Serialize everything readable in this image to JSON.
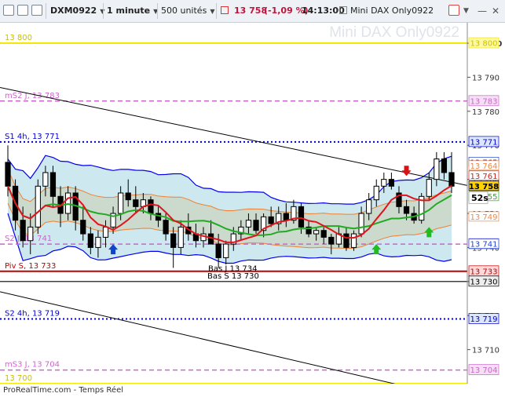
{
  "toolbar": {
    "ticker": "DXM0922",
    "interval": "1 minute",
    "units": "500 unités",
    "last_price": "13 758",
    "change": "(-1,09 %)",
    "time": "14:13:00",
    "instrument": "Mini DAX Only0922"
  },
  "colors": {
    "price_down": "#c0143c",
    "bollinger_fill": "#add8e6",
    "bollinger_line": "#0000ee",
    "sma_fast": "#e0141c",
    "sma_slow": "#22aa22",
    "keltner": "#f08030"
  },
  "watermark": "Mini DAX Only0922",
  "footer": "ProRealTime.com - Temps Réel",
  "countdown": "52s",
  "axis": {
    "min": 13700,
    "max": 13806,
    "ticks": [
      {
        "value": 13800,
        "label": "13 800"
      },
      {
        "value": 13790,
        "label": "13 790"
      },
      {
        "value": 13780,
        "label": "13 780"
      },
      {
        "value": 13770,
        "label": "13 770"
      },
      {
        "value": 13760,
        "label": "13 760"
      },
      {
        "value": 13750,
        "label": "13 750"
      },
      {
        "value": 13740,
        "label": "13 740"
      },
      {
        "value": 13730,
        "label": "13 730"
      },
      {
        "value": 13720,
        "label": "13 720"
      },
      {
        "value": 13710,
        "label": "13 710"
      }
    ]
  },
  "levels": [
    {
      "value": 13800,
      "label": "13 800",
      "style": "yellow",
      "tag": "13 800"
    },
    {
      "value": 13783,
      "label": "mS2 J, 13 783",
      "style": "violet",
      "tag": "13 783"
    },
    {
      "value": 13771,
      "label": "S1 4h, 13 771",
      "style": "blue",
      "tag": "13 771"
    },
    {
      "value": 13741,
      "label": "S2 J, 13 741",
      "style": "violet",
      "tag": "13 741"
    },
    {
      "value": 13733,
      "label": "Piv S, 13 733",
      "style": "red",
      "tag": "13 733"
    },
    {
      "value": 13730,
      "label": "Bas S 13 730",
      "style": "black",
      "tag": "13 730"
    },
    {
      "value": 13719,
      "label": "S2 4h, 13 719",
      "style": "blue",
      "tag": "13 719"
    },
    {
      "value": 13704,
      "label": "mS3 J, 13 704",
      "style": "violet",
      "tag": "13 704"
    },
    {
      "value": 13700,
      "label": "13 700",
      "style": "yellow",
      "tag": ""
    }
  ],
  "annotations": [
    {
      "text": "Bas J 13 734",
      "value": 13734
    }
  ],
  "price_tags": [
    {
      "value": 13765,
      "label": "13 765",
      "color": "#2244cc"
    },
    {
      "value": 13764,
      "label": "13 764",
      "color": "#ee8844"
    },
    {
      "value": 13761,
      "label": "13 761",
      "color": "#cc2222"
    },
    {
      "value": 13758,
      "label": "13 758",
      "color": "#000000",
      "bg": "#ffd400"
    },
    {
      "value": 13755,
      "label": "13 755",
      "color": "#22aa22"
    },
    {
      "value": 13749,
      "label": "13 749",
      "color": "#ee8844"
    },
    {
      "value": 13741,
      "label": "13 741",
      "color": "#2244cc"
    }
  ],
  "chart_data": {
    "type": "candlestick",
    "candles": [
      {
        "o": 13765,
        "h": 13770,
        "l": 13755,
        "c": 13758
      },
      {
        "o": 13758,
        "h": 13760,
        "l": 13745,
        "c": 13748
      },
      {
        "o": 13748,
        "h": 13752,
        "l": 13740,
        "c": 13742
      },
      {
        "o": 13742,
        "h": 13750,
        "l": 13738,
        "c": 13746
      },
      {
        "o": 13746,
        "h": 13760,
        "l": 13744,
        "c": 13758
      },
      {
        "o": 13758,
        "h": 13764,
        "l": 13755,
        "c": 13762
      },
      {
        "o": 13762,
        "h": 13764,
        "l": 13752,
        "c": 13755
      },
      {
        "o": 13755,
        "h": 13758,
        "l": 13746,
        "c": 13750
      },
      {
        "o": 13750,
        "h": 13758,
        "l": 13748,
        "c": 13756
      },
      {
        "o": 13756,
        "h": 13758,
        "l": 13745,
        "c": 13748
      },
      {
        "o": 13748,
        "h": 13752,
        "l": 13742,
        "c": 13744
      },
      {
        "o": 13744,
        "h": 13746,
        "l": 13738,
        "c": 13740
      },
      {
        "o": 13740,
        "h": 13745,
        "l": 13737,
        "c": 13743
      },
      {
        "o": 13743,
        "h": 13748,
        "l": 13740,
        "c": 13746
      },
      {
        "o": 13746,
        "h": 13752,
        "l": 13744,
        "c": 13750
      },
      {
        "o": 13750,
        "h": 13758,
        "l": 13748,
        "c": 13756
      },
      {
        "o": 13756,
        "h": 13760,
        "l": 13752,
        "c": 13754
      },
      {
        "o": 13754,
        "h": 13758,
        "l": 13750,
        "c": 13752
      },
      {
        "o": 13752,
        "h": 13756,
        "l": 13750,
        "c": 13754
      },
      {
        "o": 13754,
        "h": 13755,
        "l": 13748,
        "c": 13750
      },
      {
        "o": 13750,
        "h": 13752,
        "l": 13746,
        "c": 13748
      },
      {
        "o": 13748,
        "h": 13750,
        "l": 13742,
        "c": 13744
      },
      {
        "o": 13744,
        "h": 13746,
        "l": 13734,
        "c": 13740
      },
      {
        "o": 13740,
        "h": 13748,
        "l": 13738,
        "c": 13746
      },
      {
        "o": 13746,
        "h": 13750,
        "l": 13742,
        "c": 13744
      },
      {
        "o": 13744,
        "h": 13747,
        "l": 13740,
        "c": 13742
      },
      {
        "o": 13742,
        "h": 13746,
        "l": 13740,
        "c": 13744
      },
      {
        "o": 13744,
        "h": 13748,
        "l": 13742,
        "c": 13741
      },
      {
        "o": 13741,
        "h": 13744,
        "l": 13734,
        "c": 13737
      },
      {
        "o": 13737,
        "h": 13742,
        "l": 13735,
        "c": 13741
      },
      {
        "o": 13741,
        "h": 13746,
        "l": 13739,
        "c": 13744
      },
      {
        "o": 13744,
        "h": 13748,
        "l": 13742,
        "c": 13746
      },
      {
        "o": 13746,
        "h": 13750,
        "l": 13744,
        "c": 13748
      },
      {
        "o": 13748,
        "h": 13750,
        "l": 13744,
        "c": 13745
      },
      {
        "o": 13745,
        "h": 13750,
        "l": 13743,
        "c": 13749
      },
      {
        "o": 13749,
        "h": 13752,
        "l": 13746,
        "c": 13747
      },
      {
        "o": 13747,
        "h": 13752,
        "l": 13745,
        "c": 13750
      },
      {
        "o": 13750,
        "h": 13753,
        "l": 13746,
        "c": 13748
      },
      {
        "o": 13748,
        "h": 13754,
        "l": 13747,
        "c": 13752
      },
      {
        "o": 13752,
        "h": 13753,
        "l": 13744,
        "c": 13746
      },
      {
        "o": 13746,
        "h": 13748,
        "l": 13743,
        "c": 13744
      },
      {
        "o": 13744,
        "h": 13746,
        "l": 13742,
        "c": 13745
      },
      {
        "o": 13745,
        "h": 13746,
        "l": 13741,
        "c": 13743
      },
      {
        "o": 13743,
        "h": 13744,
        "l": 13738,
        "c": 13741
      },
      {
        "o": 13741,
        "h": 13746,
        "l": 13740,
        "c": 13744
      },
      {
        "o": 13744,
        "h": 13746,
        "l": 13739,
        "c": 13740
      },
      {
        "o": 13740,
        "h": 13745,
        "l": 13739,
        "c": 13744
      },
      {
        "o": 13744,
        "h": 13752,
        "l": 13743,
        "c": 13750
      },
      {
        "o": 13750,
        "h": 13756,
        "l": 13748,
        "c": 13754
      },
      {
        "o": 13754,
        "h": 13760,
        "l": 13752,
        "c": 13758
      },
      {
        "o": 13758,
        "h": 13762,
        "l": 13756,
        "c": 13760
      },
      {
        "o": 13760,
        "h": 13762,
        "l": 13757,
        "c": 13758
      },
      {
        "o": 13756,
        "h": 13758,
        "l": 13750,
        "c": 13752
      },
      {
        "o": 13752,
        "h": 13754,
        "l": 13748,
        "c": 13750
      },
      {
        "o": 13750,
        "h": 13752,
        "l": 13747,
        "c": 13748
      },
      {
        "o": 13748,
        "h": 13756,
        "l": 13747,
        "c": 13755
      },
      {
        "o": 13755,
        "h": 13762,
        "l": 13754,
        "c": 13760
      },
      {
        "o": 13760,
        "h": 13768,
        "l": 13758,
        "c": 13766
      },
      {
        "o": 13766,
        "h": 13768,
        "l": 13760,
        "c": 13762
      },
      {
        "o": 13762,
        "h": 13768,
        "l": 13756,
        "c": 13758
      }
    ],
    "signals": [
      {
        "index": 14,
        "dir": "up",
        "price": 13741
      },
      {
        "index": 49,
        "dir": "up",
        "price": 13741
      },
      {
        "index": 53,
        "dir": "down",
        "price": 13764
      },
      {
        "index": 56,
        "dir": "up",
        "price": 13746
      }
    ]
  }
}
